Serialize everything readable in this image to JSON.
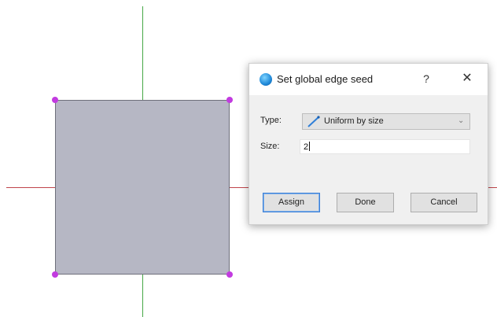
{
  "dialog": {
    "title": "Set global edge seed",
    "help_glyph": "?",
    "close_glyph": "✕",
    "type_label": "Type:",
    "type_value": "Uniform by size",
    "size_label": "Size:",
    "size_value": "2",
    "buttons": {
      "assign": "Assign",
      "done": "Done",
      "cancel": "Cancel"
    }
  },
  "viewport": {
    "x_axis_color": "#c0454b",
    "y_axis_color": "#45a845",
    "shape_fill": "#b6b7c4",
    "vertex_color": "#c23be0"
  },
  "icons": {
    "app": "abaqus-app-icon",
    "type": "seed-size-icon",
    "dropdown": "chevron-down-icon"
  }
}
